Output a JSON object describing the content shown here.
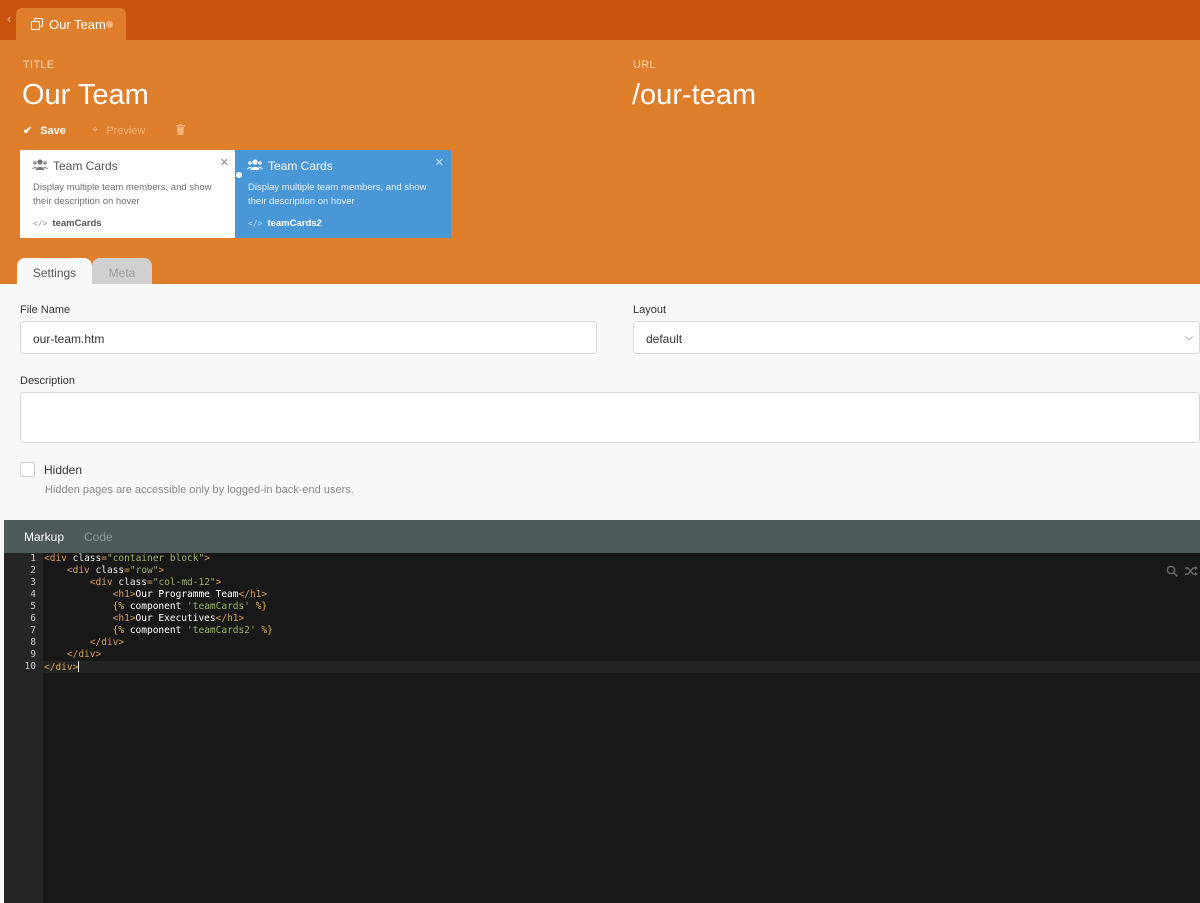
{
  "tab": {
    "label": "Our Team",
    "icon": "copy-icon"
  },
  "header": {
    "title_label": "TITLE",
    "title": "Our Team",
    "url_label": "URL",
    "url": "/our-team",
    "toolbar": {
      "save": "Save",
      "preview": "Preview"
    }
  },
  "components": [
    {
      "title": "Team Cards",
      "description": "Display multiple team members, and show their description on hover",
      "alias": "teamCards",
      "icon": "users-icon"
    },
    {
      "title": "Team Cards",
      "description": "Display multiple team members, and show their description on hover",
      "alias": "teamCards2",
      "icon": "users-icon"
    }
  ],
  "form_tabs": [
    "Settings",
    "Meta"
  ],
  "form": {
    "file_name_label": "File Name",
    "file_name": "our-team.htm",
    "layout_label": "Layout",
    "layout": "default",
    "description_label": "Description",
    "description": "",
    "hidden_label": "Hidden",
    "hidden_help": "Hidden pages are accessible only by logged-in back-end users."
  },
  "editor": {
    "tabs": [
      "Markup",
      "Code"
    ],
    "line_numbers": [
      "1",
      "2",
      "3",
      "4",
      "5",
      "6",
      "7",
      "8",
      "9",
      "10"
    ],
    "lines": [
      "<div class=\"container block\">",
      "    <div class=\"row\">",
      "        <div class=\"col-md-12\">",
      "            <h1>Our Programme Team</h1>",
      "            {% component 'teamCards' %}",
      "            <h1>Our Executives</h1>",
      "            {% component 'teamCards2' %}",
      "        </div>",
      "    </div>",
      "</div>"
    ]
  }
}
